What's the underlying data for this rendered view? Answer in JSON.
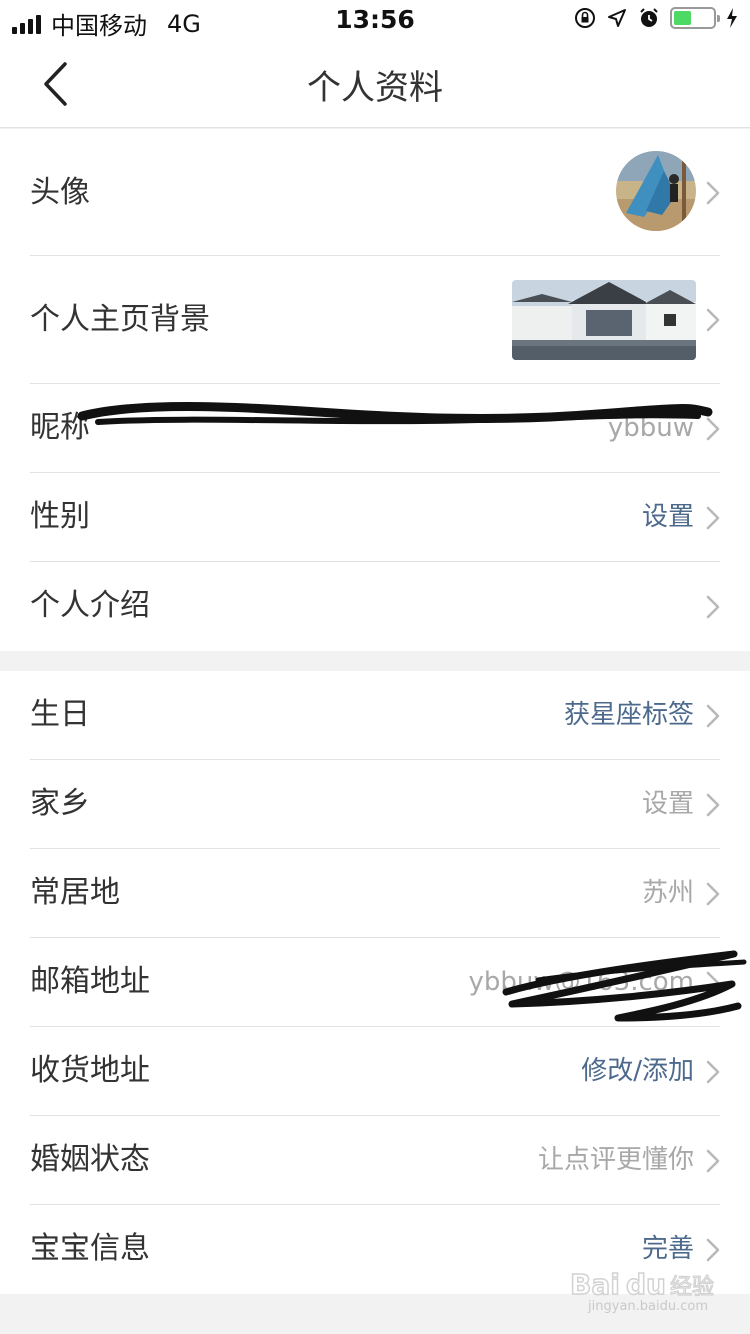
{
  "status_bar": {
    "carrier": "中国移动",
    "network": "4G",
    "time": "13:56",
    "battery_level": 0.45
  },
  "nav": {
    "title": "个人资料"
  },
  "profile_rows": [
    {
      "label": "头像",
      "value": ""
    },
    {
      "label": "个人主页背景",
      "value": ""
    },
    {
      "label": "昵称",
      "value": "ybbuw"
    },
    {
      "label": "性别",
      "value": "设置"
    },
    {
      "label": "个人介绍",
      "value": ""
    }
  ],
  "detail_rows": [
    {
      "label": "生日",
      "value": "获星座标签"
    },
    {
      "label": "家乡",
      "value": "设置"
    },
    {
      "label": "常居地",
      "value": "苏州"
    },
    {
      "label": "邮箱地址",
      "value": "ybbuw@163.com"
    },
    {
      "label": "收货地址",
      "value": "修改/添加"
    },
    {
      "label": "婚姻状态",
      "value": "让点评更懂你"
    },
    {
      "label": "宝宝信息",
      "value": "完善"
    }
  ],
  "watermark": {
    "site": "jingyan.baidu.com"
  },
  "colors": {
    "accent_blue": "#4d6a8c",
    "value_gray": "#a8a8a8",
    "battery_green": "#4cd964"
  },
  "icons": [
    "signal-icon",
    "lock-rotation-icon",
    "location-arrow-icon",
    "alarm-icon",
    "battery-icon",
    "charging-bolt-icon",
    "back-chevron-icon",
    "chevron-right-icon"
  ]
}
